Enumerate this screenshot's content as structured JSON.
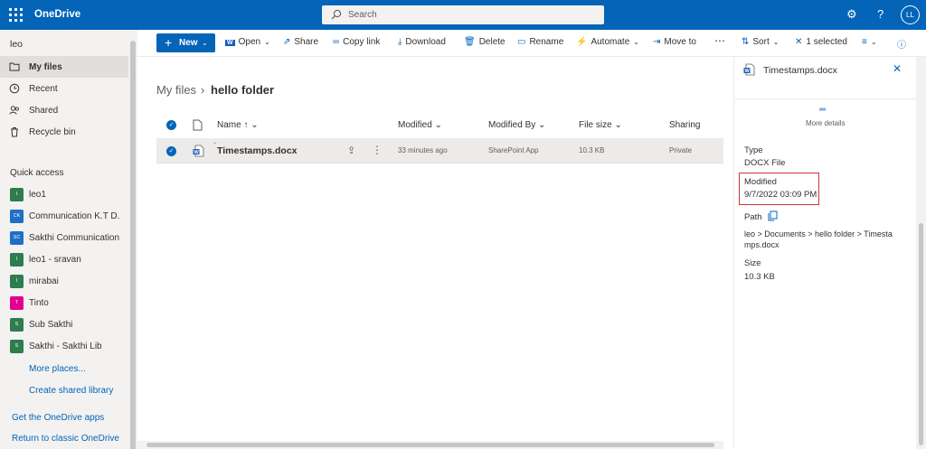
{
  "app": {
    "name": "OneDrive"
  },
  "search": {
    "placeholder": "Search"
  },
  "header": {
    "avatar_initials": "LL"
  },
  "nav": {
    "user": "leo",
    "items": [
      {
        "label": "My files",
        "selected": true
      },
      {
        "label": "Recent"
      },
      {
        "label": "Shared"
      },
      {
        "label": "Recycle bin"
      }
    ],
    "quick_access_title": "Quick access",
    "quick_access": [
      {
        "label": "leo1",
        "initials": "l",
        "color": "#2e7d4f"
      },
      {
        "label": "Communication K.T D...",
        "initials": "CK",
        "color": "#1f6fc5"
      },
      {
        "label": "Sakthi Communication",
        "initials": "SC",
        "color": "#1f6fc5"
      },
      {
        "label": "leo1 - sravan",
        "initials": "l",
        "color": "#2e7d4f"
      },
      {
        "label": "mirabai",
        "initials": "I",
        "color": "#2e7d4f"
      },
      {
        "label": "Tinto",
        "initials": "T",
        "color": "#e3008c"
      },
      {
        "label": "Sub Sakthi",
        "initials": "S",
        "color": "#2e7d4f"
      },
      {
        "label": "Sakthi - Sakthi Lib",
        "initials": "S",
        "color": "#2e7d4f"
      }
    ],
    "more_places": "More places...",
    "create_library": "Create shared library",
    "get_apps": "Get the OneDrive apps",
    "return_classic": "Return to classic OneDrive"
  },
  "commands": {
    "new": "New",
    "open": "Open",
    "share": "Share",
    "copy_link": "Copy link",
    "download": "Download",
    "delete": "Delete",
    "rename": "Rename",
    "automate": "Automate",
    "move_to": "Move to",
    "sort": "Sort",
    "selected": "1 selected"
  },
  "breadcrumb": {
    "root": "My files",
    "current": "hello folder"
  },
  "columns": {
    "name": "Name",
    "modified": "Modified",
    "modified_by": "Modified By",
    "file_size": "File size",
    "sharing": "Sharing"
  },
  "files": [
    {
      "name": "Timestamps.docx",
      "modified": "33 minutes ago",
      "modified_by": "SharePoint App",
      "size": "10.3 KB",
      "sharing": "Private"
    }
  ],
  "details": {
    "file_name": "Timestamps.docx",
    "more_details": "More details",
    "type_label": "Type",
    "type_value": "DOCX File",
    "modified_label": "Modified",
    "modified_value": "9/7/2022 03:09 PM",
    "path_label": "Path",
    "path_line1": "leo  >  Documents  >  hello folder  >  Timesta",
    "path_line2": "mps.docx",
    "size_label": "Size",
    "size_value": "10.3 KB"
  },
  "colors": {
    "brand": "#0364b8",
    "highlight": "#d13438"
  }
}
